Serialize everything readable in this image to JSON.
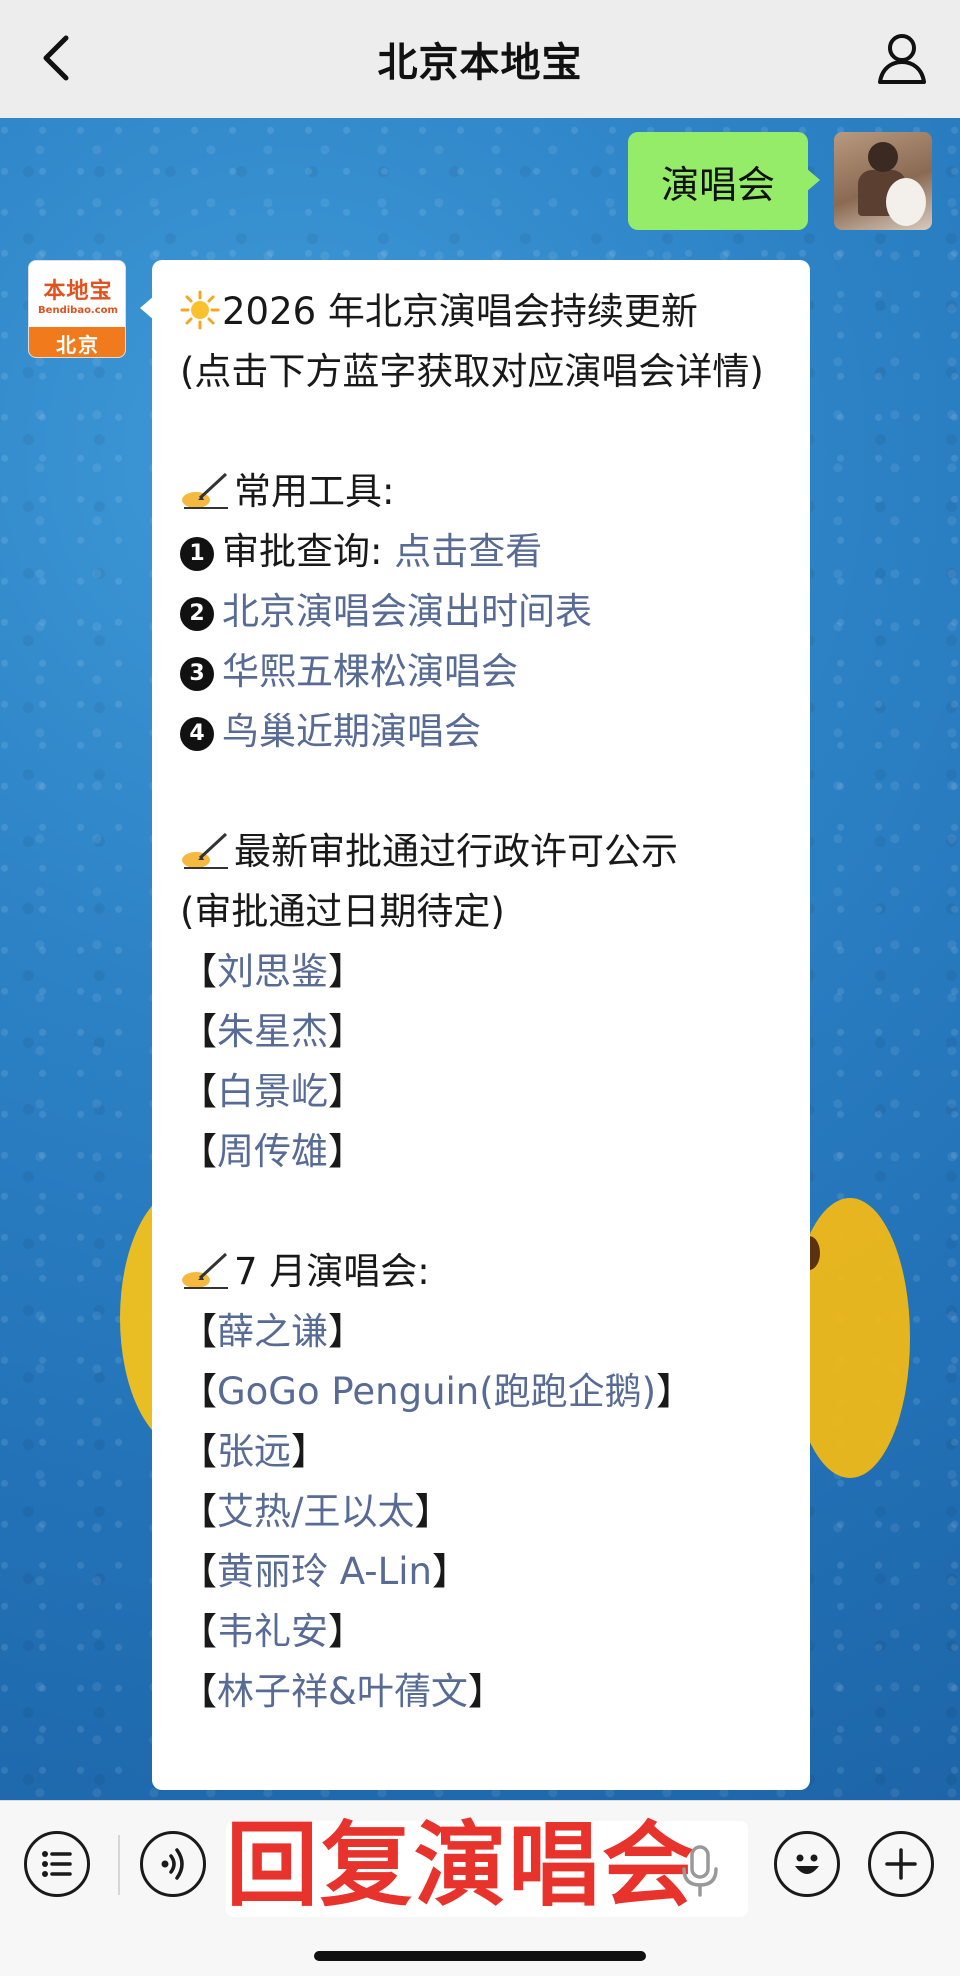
{
  "header": {
    "title": "北京本地宝"
  },
  "user_message": {
    "text": "演唱会"
  },
  "bot_avatar": {
    "brand": "本地宝",
    "site": "Bendibao.com",
    "city": "北京"
  },
  "bot_message": {
    "intro_line1": "2026 年北京演唱会持续更新",
    "intro_line2": "(点击下方蓝字获取对应演唱会详情)",
    "tools_heading": "常用工具:",
    "tool1_label": "审批查询:",
    "tool1_link": "点击查看",
    "tool2_link": "北京演唱会演出时间表",
    "tool3_link": "华熙五棵松演唱会",
    "tool4_link": "鸟巢近期演唱会",
    "approval_heading": "最新审批通过行政许可公示",
    "approval_note": "(审批通过日期待定)",
    "approved_names": [
      "刘思鉴",
      "朱星杰",
      "白景屹",
      "周传雄"
    ],
    "july_heading": "7 月演唱会:",
    "july_names": [
      "薛之谦",
      "GoGo Penguin(跑跑企鹅)",
      "张远",
      "艾热/王以太",
      "黄丽玲 A-Lin",
      "韦礼安",
      "林子祥&叶蒨文"
    ],
    "bracket_open": "【",
    "bracket_close": "】"
  },
  "numbers": [
    "1",
    "2",
    "3",
    "4"
  ],
  "bottom_bar": {
    "overlay_text": "回复演唱会"
  },
  "colors": {
    "link": "#576b95",
    "user_bubble": "#95ec69",
    "overlay": "#e8322c"
  },
  "icons": [
    "back-arrow-icon",
    "profile-icon",
    "sun-icon",
    "writing-hand-icon",
    "menu-list-icon",
    "voice-icon",
    "microphone-icon",
    "emoji-icon",
    "plus-icon"
  ]
}
